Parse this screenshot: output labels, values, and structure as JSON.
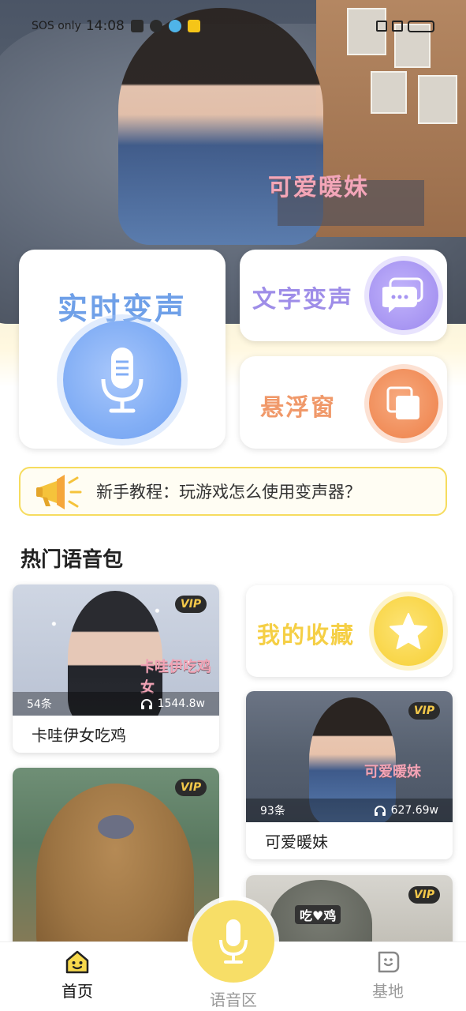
{
  "status_bar": {
    "carrier": "SOS only",
    "time": "14:08"
  },
  "hero": {
    "tag": "可爱暖妹"
  },
  "features": {
    "realtime": {
      "label": "实时变声",
      "icon": "microphone-icon",
      "color": "#6fa0e8"
    },
    "text": {
      "label": "文字变声",
      "icon": "chat-bubble-icon",
      "color": "#9e8de8"
    },
    "float": {
      "label": "悬浮窗",
      "icon": "floating-window-icon",
      "color": "#f0996a"
    }
  },
  "tutorial": {
    "text": "新手教程：玩游戏怎么使用变声器？",
    "icon": "megaphone-icon"
  },
  "hot_packs": {
    "title": "热门语音包",
    "favorites_label": "我的收藏",
    "items": [
      {
        "name": "卡哇伊女吃鸡",
        "count": "54条",
        "plays": "1544.8w",
        "badge": "VIP",
        "overlay": "卡哇伊吃鸡女"
      },
      {
        "name": "可爱暖妹",
        "count": "93条",
        "plays": "627.69w",
        "badge": "VIP",
        "overlay": "可爱暖妹"
      },
      {
        "name": "",
        "count": "",
        "plays": "",
        "badge": "VIP"
      },
      {
        "name": "",
        "count": "",
        "plays": "",
        "badge": "VIP",
        "overlay": "吃♥鸡"
      }
    ]
  },
  "bottom_nav": {
    "home": "首页",
    "voice": "语音区",
    "base": "基地"
  },
  "colors": {
    "accent_yellow": "#f7de67",
    "vip_text": "#f3c84a"
  }
}
